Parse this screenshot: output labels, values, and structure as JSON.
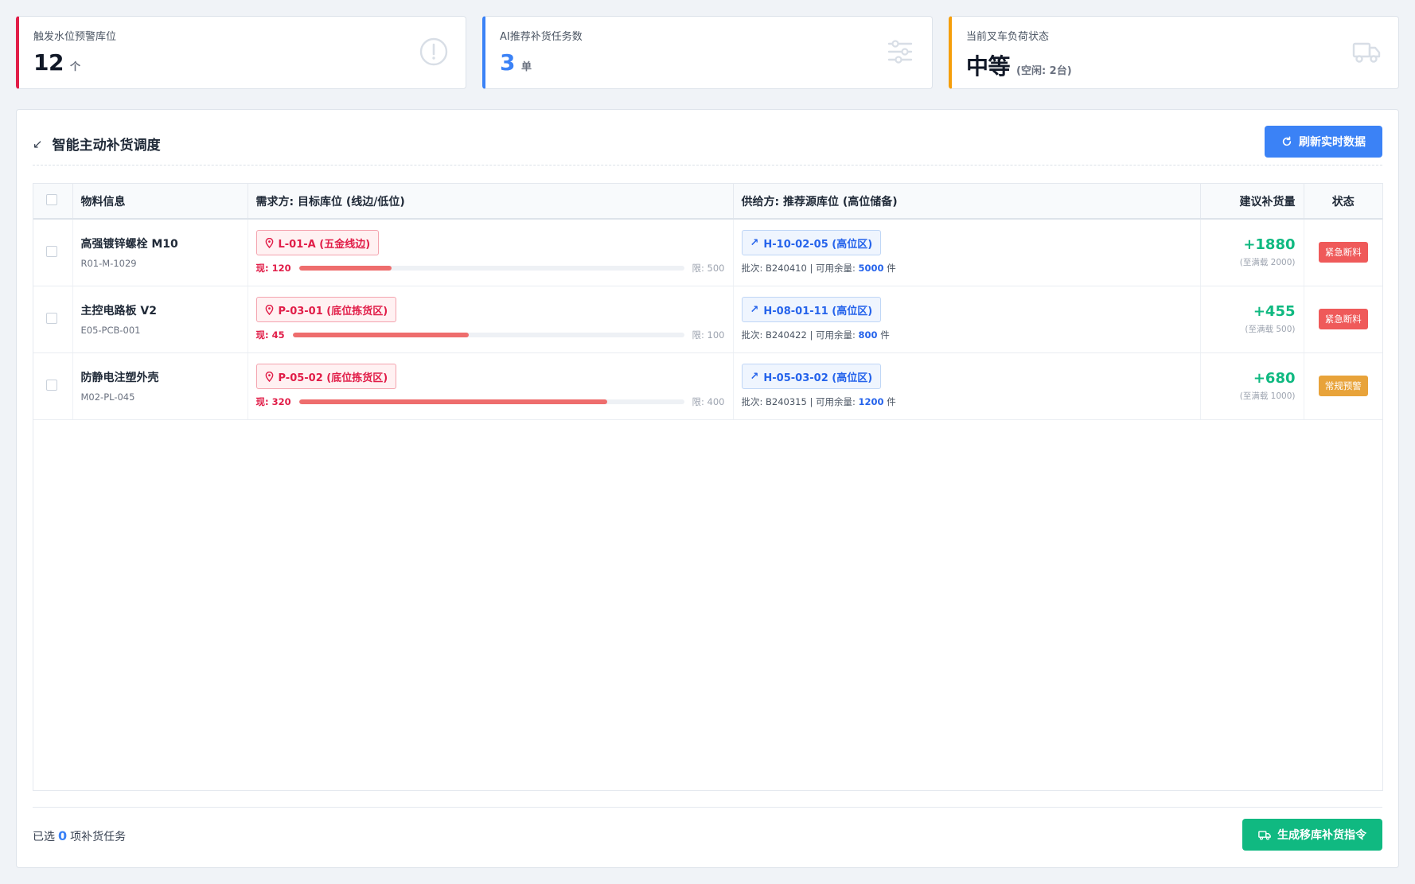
{
  "stats": [
    {
      "label": "触发水位预警库位",
      "value": "12",
      "unit": "个"
    },
    {
      "label": "AI推荐补货任务数",
      "value": "3",
      "unit": "单"
    },
    {
      "label": "当前叉车负荷状态",
      "value": "中等",
      "unit": "(空闲: 2台)"
    }
  ],
  "panel": {
    "title": "智能主动补货调度",
    "refresh_label": "刷新实时数据"
  },
  "table": {
    "headers": [
      "物料信息",
      "需求方: 目标库位 (线边/低位)",
      "供给方: 推荐源库位 (高位储备)",
      "建议补货量",
      "状态"
    ],
    "rows": [
      {
        "name": "高强镀锌螺栓 M10",
        "code": "R01-M-1029",
        "target": "L-01-A (五金线边)",
        "current": "现: 120",
        "limit": "限: 500",
        "fill": 0.24,
        "source": "H-10-02-05 (高位区)",
        "batch": "批次: B240410 | 可用余量:",
        "avail": "5000",
        "unit": "件",
        "qty": "+1880",
        "qty_sub": "(至满载 2000)",
        "status": "紧急断料",
        "status_type": "danger"
      },
      {
        "name": "主控电路板 V2",
        "code": "E05-PCB-001",
        "target": "P-03-01 (底位拣货区)",
        "current": "现: 45",
        "limit": "限: 100",
        "fill": 0.45,
        "source": "H-08-01-11 (高位区)",
        "batch": "批次: B240422 | 可用余量:",
        "avail": "800",
        "unit": "件",
        "qty": "+455",
        "qty_sub": "(至满载 500)",
        "status": "紧急断料",
        "status_type": "danger"
      },
      {
        "name": "防静电注塑外壳",
        "code": "M02-PL-045",
        "target": "P-05-02 (底位拣货区)",
        "current": "现: 320",
        "limit": "限: 400",
        "fill": 0.8,
        "source": "H-05-03-02 (高位区)",
        "batch": "批次: B240315 | 可用余量:",
        "avail": "1200",
        "unit": "件",
        "qty": "+680",
        "qty_sub": "(至满载 1000)",
        "status": "常规预警",
        "status_type": "warn"
      }
    ]
  },
  "footer": {
    "selected_prefix": "已选",
    "selected_count": "0",
    "selected_suffix": "项补货任务",
    "generate_label": "生成移库补货指令"
  },
  "colors": {
    "danger": "#e11d48",
    "primary": "#3b82f6",
    "success": "#10b981",
    "warning": "#f59e0b"
  }
}
